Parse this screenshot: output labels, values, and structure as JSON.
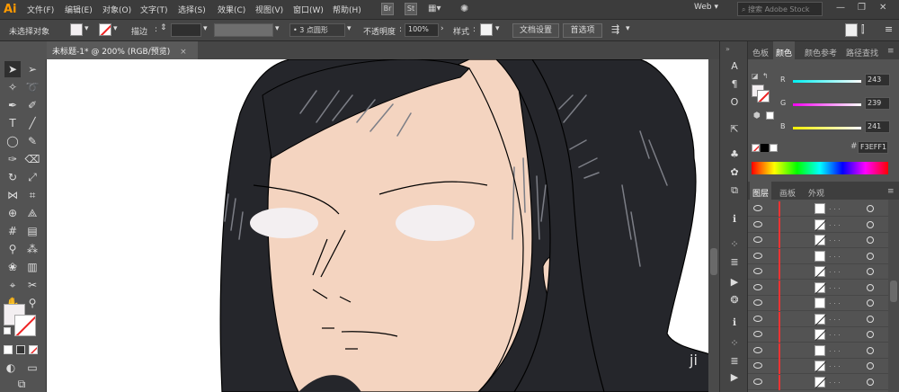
{
  "app": {
    "logo": "Ai"
  },
  "menu": [
    "文件(F)",
    "编辑(E)",
    "对象(O)",
    "文字(T)",
    "选择(S)",
    "效果(C)",
    "视图(V)",
    "窗口(W)",
    "帮助(H)"
  ],
  "menubar_extras": {
    "br": "Br",
    "st": "St",
    "workspace": "Web",
    "search_placeholder": "搜索 Adobe Stock"
  },
  "control": {
    "no_selection": "未选择对象",
    "stroke_label": "描边",
    "brush_size": "3 点圆形",
    "opacity_label": "不透明度",
    "opacity_value": "100%",
    "style_label": "样式",
    "doc_setup": "文档设置",
    "preferences": "首选项"
  },
  "document_tab": "未标题-1* @ 200% (RGB/预览)",
  "color_panel": {
    "tabs": [
      "色板",
      "颜色",
      "颜色参考",
      "路径查找"
    ],
    "active_tab": "颜色",
    "r_label": "R",
    "r_value": "243",
    "g_label": "G",
    "g_value": "239",
    "b_label": "B",
    "b_value": "241",
    "hex": "F3EFF1"
  },
  "layers_panel": {
    "tabs": [
      "图层",
      "画板",
      "外观"
    ],
    "active_tab": "图层",
    "rows": 12
  },
  "colors": {
    "fill": "#f3eff1",
    "hair": "#25262b",
    "skin": "#f4d4c0",
    "accent": "#ff9a00"
  },
  "watermark": "ji"
}
